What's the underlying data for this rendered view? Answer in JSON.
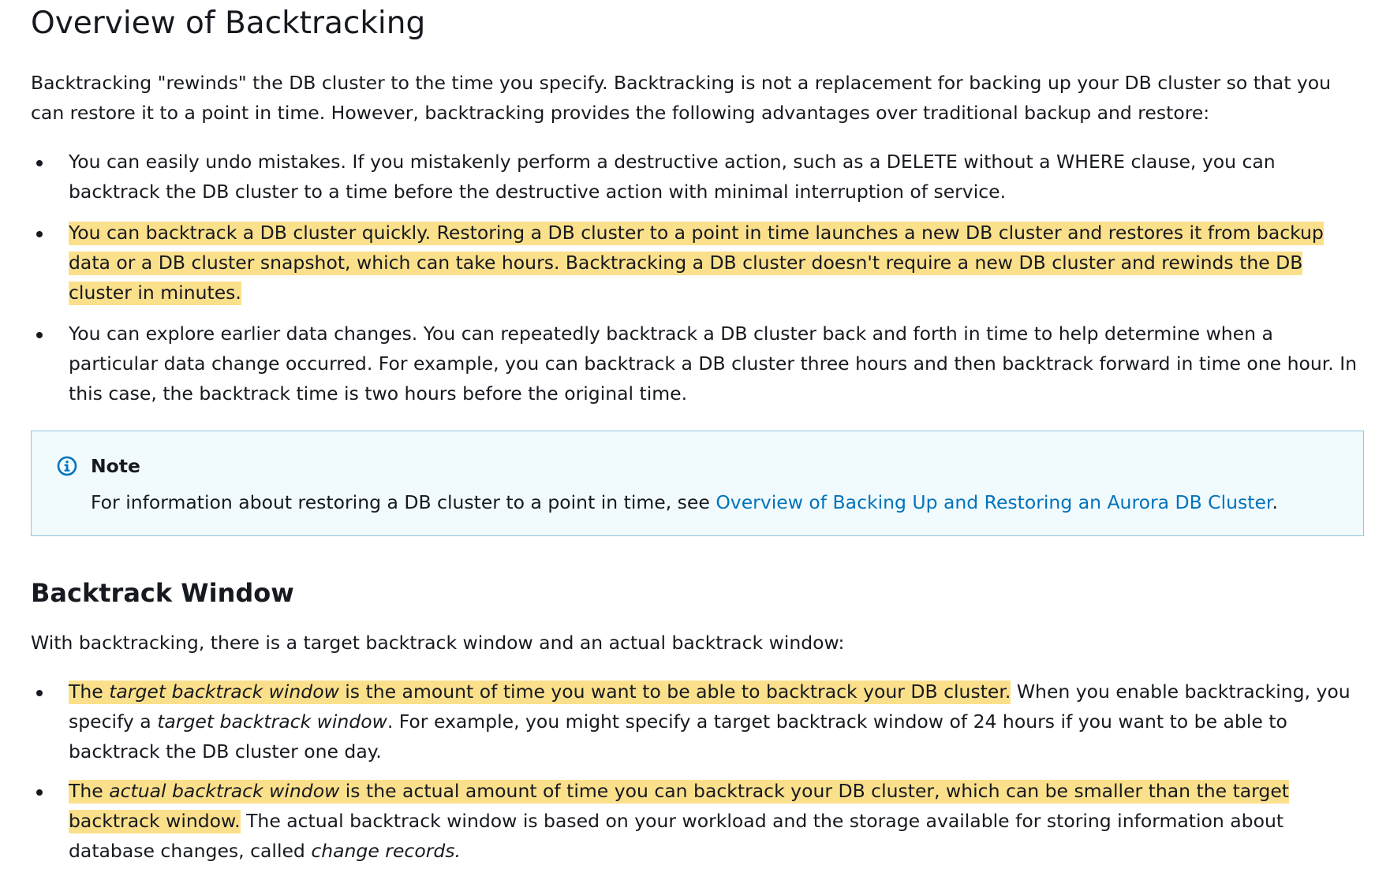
{
  "title": "Overview of Backtracking",
  "intro": "Backtracking \"rewinds\" the DB cluster to the time you specify. Backtracking is not a replacement for backing up your DB cluster so that you can restore it to a point in time. However, backtracking provides the following advantages over traditional backup and restore:",
  "advantages": [
    "You can easily undo mistakes. If you mistakenly perform a destructive action, such as a DELETE without a WHERE clause, you can backtrack the DB cluster to a time before the destructive action with minimal interruption of service.",
    "You can backtrack a DB cluster quickly. Restoring a DB cluster to a point in time launches a new DB cluster and restores it from backup data or a DB cluster snapshot, which can take hours. Backtracking a DB cluster doesn't require a new DB cluster and rewinds the DB cluster in minutes.",
    "You can explore earlier data changes. You can repeatedly backtrack a DB cluster back and forth in time to help determine when a particular data change occurred. For example, you can backtrack a DB cluster three hours and then backtrack forward in time one hour. In this case, the backtrack time is two hours before the original time."
  ],
  "note": {
    "title": "Note",
    "text": "For information about restoring a DB cluster to a point in time, see ",
    "link": "Overview of Backing Up and Restoring an Aurora DB Cluster",
    "after": "."
  },
  "section2": {
    "heading": "Backtrack Window",
    "intro": "With backtracking, there is a target backtrack window and an actual backtrack window:",
    "item1": {
      "hl_pre": "The ",
      "hl_em": "target backtrack window",
      "hl_post": " is the amount of time you want to be able to backtrack your DB cluster.",
      "rest_pre": " When you enable backtracking, you specify a ",
      "rest_em": "target backtrack window",
      "rest_post": ". For example, you might specify a target backtrack window of 24 hours if you want to be able to backtrack the DB cluster one day."
    },
    "item2": {
      "hl_pre": "The ",
      "hl_em": "actual backtrack window",
      "hl_post": " is the actual amount of time you can backtrack your DB cluster, which can be smaller than the target backtrack window.",
      "rest_pre": " The actual backtrack window is based on your workload and the storage available for storing information about database changes, called ",
      "rest_em": "change records.",
      "rest_post": ""
    }
  },
  "colors": {
    "highlight": "#fbe08c",
    "link": "#0073bb",
    "note_border": "#8ec6dd",
    "note_bg": "#f1fafd"
  }
}
